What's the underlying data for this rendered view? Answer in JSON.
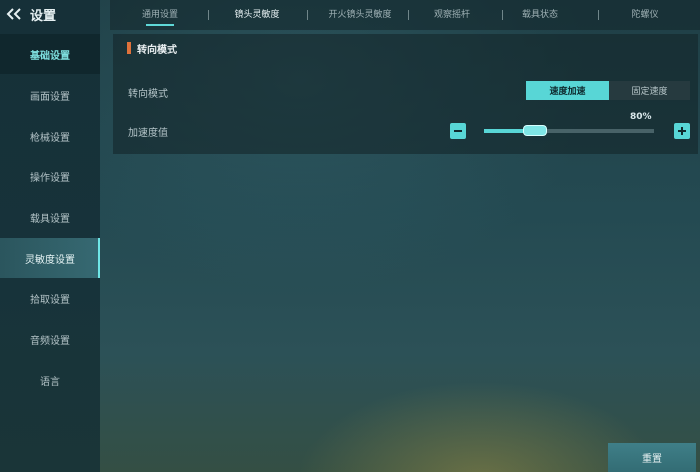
{
  "sidebar": {
    "title": "设置",
    "items": [
      {
        "label": "基础设置"
      },
      {
        "label": "画面设置"
      },
      {
        "label": "枪械设置"
      },
      {
        "label": "操作设置"
      },
      {
        "label": "载具设置"
      },
      {
        "label": "灵敏度设置"
      },
      {
        "label": "拾取设置"
      },
      {
        "label": "音频设置"
      },
      {
        "label": "语言"
      }
    ]
  },
  "tabs": [
    {
      "label": "通用设置"
    },
    {
      "label": "镜头灵敏度"
    },
    {
      "label": "开火镜头灵敏度"
    },
    {
      "label": "观察摇杆"
    },
    {
      "label": "载具状态"
    },
    {
      "label": "陀螺仪"
    }
  ],
  "section": {
    "title": "转向模式"
  },
  "rows": {
    "steering_mode": {
      "label": "转向模式",
      "options": [
        "速度加速",
        "固定速度"
      ],
      "selected": "速度加速"
    },
    "acceleration": {
      "label": "加速度值",
      "value": "80%",
      "level": 0.3
    }
  },
  "footer": {
    "reset_label": "重置"
  },
  "colors": {
    "accent": "#58d6d6",
    "section_marker": "#e0723b"
  },
  "icons": {
    "back": "double-chevron-left-icon",
    "minus": "minus-icon",
    "plus": "plus-icon"
  }
}
